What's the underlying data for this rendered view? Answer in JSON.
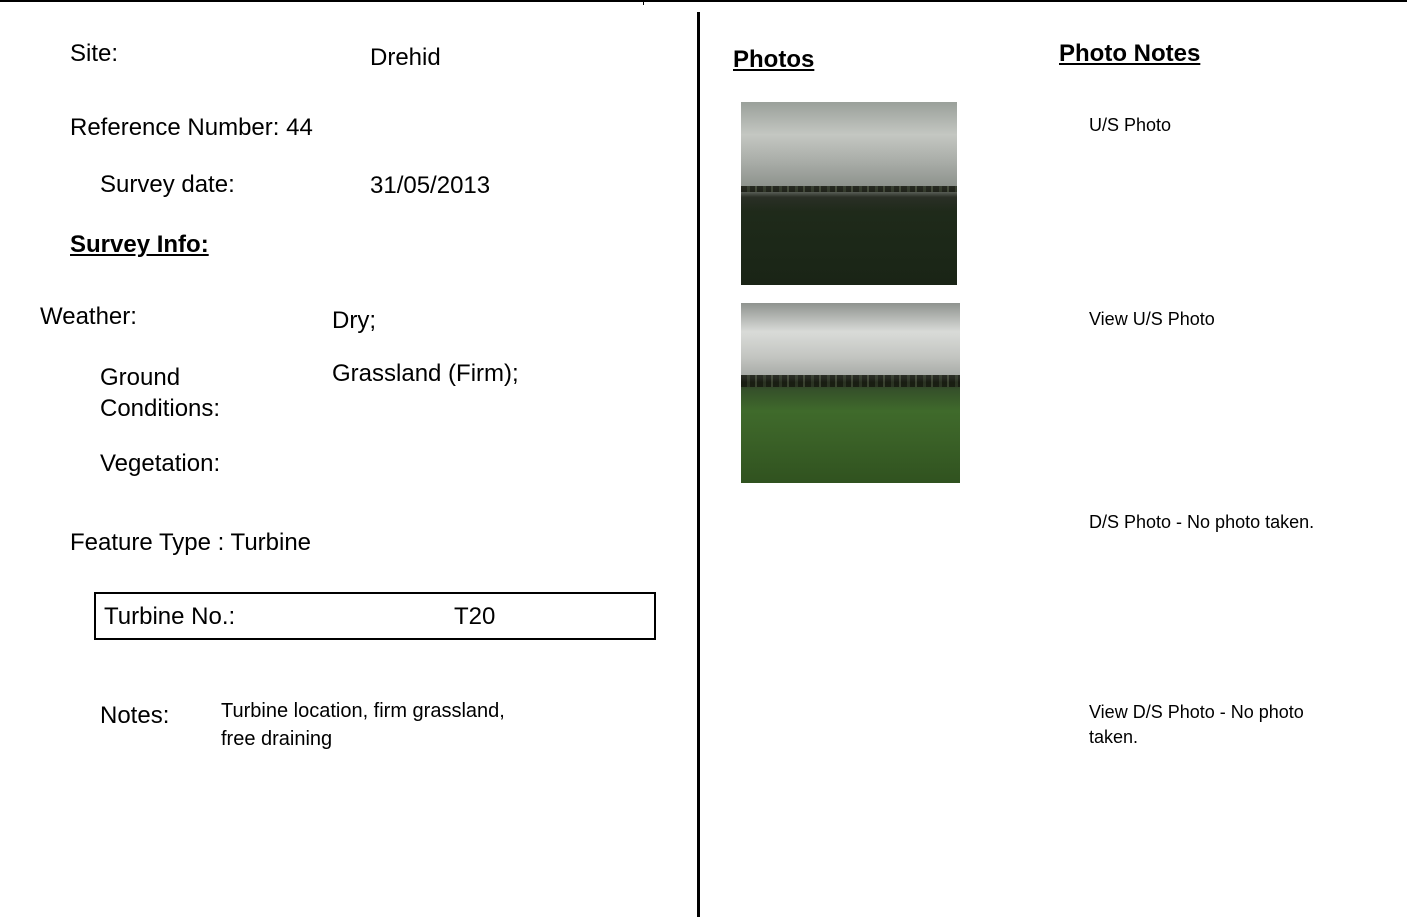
{
  "site": {
    "label": "Site:",
    "value": "Drehid"
  },
  "reference": {
    "label": "Reference Number: 44"
  },
  "survey_date": {
    "label": "Survey date:",
    "value": "31/05/2013"
  },
  "survey_info": {
    "heading": "Survey Info:"
  },
  "weather": {
    "label": "Weather:",
    "value": "Dry;"
  },
  "ground_conditions": {
    "label_line1": "Ground",
    "label_line2": "Conditions:",
    "value": "Grassland (Firm);"
  },
  "vegetation": {
    "label": "Vegetation:",
    "value": ""
  },
  "feature_type": {
    "label": "Feature Type : Turbine"
  },
  "turbine": {
    "label": "Turbine No.:",
    "value": "T20"
  },
  "notes": {
    "label": "Notes:",
    "line1": "Turbine location, firm grassland,",
    "line2": "free draining"
  },
  "photos": {
    "heading": "Photos"
  },
  "photo_notes": {
    "heading": "Photo Notes",
    "items": [
      {
        "line1": "U/S Photo",
        "line2": ""
      },
      {
        "line1": "View U/S Photo",
        "line2": ""
      },
      {
        "line1": "D/S Photo - No photo taken.",
        "line2": ""
      },
      {
        "line1": "View D/S Photo - No photo",
        "line2": "taken."
      }
    ]
  }
}
